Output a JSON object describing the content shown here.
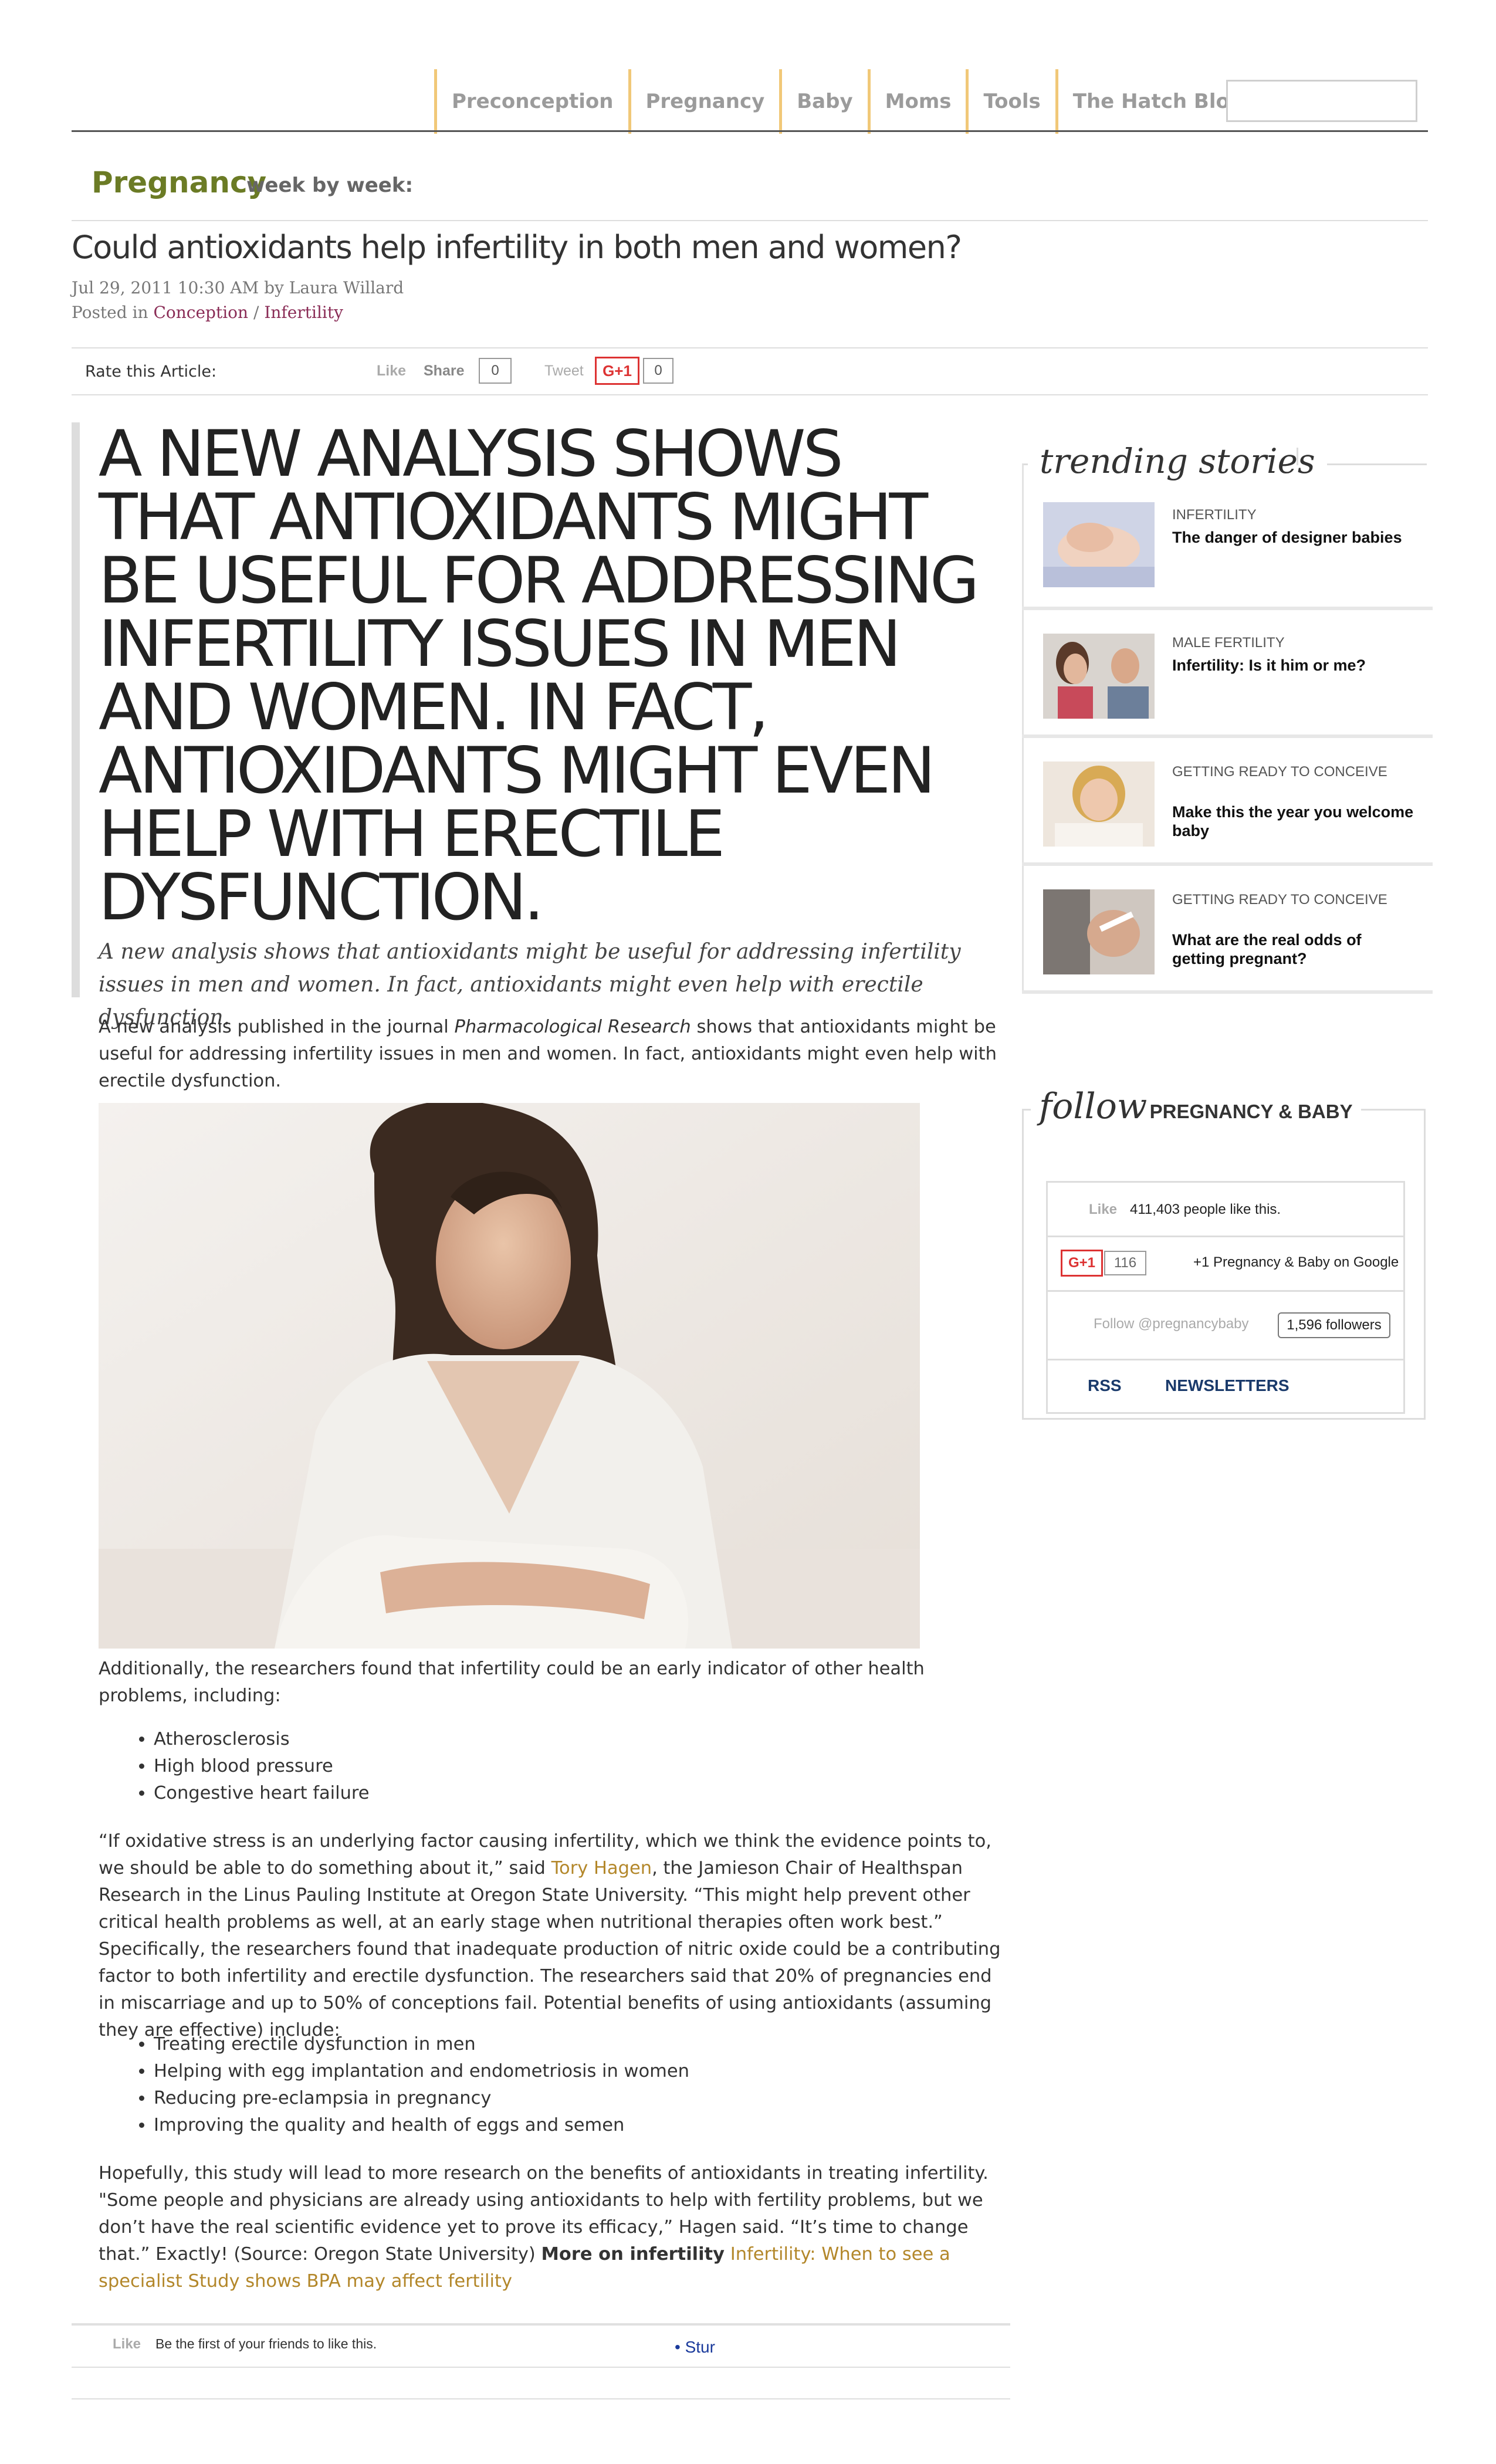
{
  "nav": {
    "items": [
      "Preconception",
      "Pregnancy",
      "Baby",
      "Moms",
      "Tools",
      "The Hatch Blog"
    ],
    "search_placeholder": ""
  },
  "section": {
    "title": "Pregnancy",
    "subtitle": "week by week:"
  },
  "article": {
    "headline": "Could antioxidants help infertility in both men and women?",
    "byline": "Jul 29, 2011 10:30 AM by Laura Willard",
    "posted_prefix": "Posted in",
    "category1": "Conception",
    "category_sep": "/",
    "category2": "Infertility"
  },
  "rate": {
    "label": "Rate this Article:",
    "like": "Like",
    "share": "Share",
    "share_count": "0",
    "tweet": "Tweet",
    "gplus": "G+1",
    "gplus_count": "0"
  },
  "pullquote": {
    "text": "A NEW ANALYSIS SHOWS THAT ANTIOXIDANTS MIGHT BE USEFUL FOR ADDRESSING INFERTILITY ISSUES IN MEN AND WOMEN. IN FACT, ANTIOXIDANTS MIGHT EVEN HELP WITH ERECTILE DYSFUNCTION.",
    "lines": [
      "A NEW ANALYSIS SHOWS",
      "THAT ANTIOXIDANTS MIGHT",
      "BE USEFUL FOR ADDRESSING",
      "INFERTILITY ISSUES IN MEN",
      "AND WOMEN. IN FACT,",
      "ANTIOXIDANTS MIGHT EVEN",
      "HELP WITH ERECTILE",
      "DYSFUNCTION."
    ],
    "subtitle": "A new analysis shows that antioxidants might be useful for addressing infertility issues in men and women. In fact, antioxidants might even help with erectile dysfunction."
  },
  "body": {
    "p1_a": "A new analysis published in the journal ",
    "p1_journal": "Pharmacological Research",
    "p1_b": " shows that antioxidants might be useful for addressing infertility issues in men and women. In fact, antioxidants might even help with erectile dysfunction.",
    "p2": "Additionally, the researchers found that infertility could be an early indicator of other health problems, including:",
    "list1": [
      "Atherosclerosis",
      "High blood pressure",
      "Congestive heart failure"
    ],
    "p3_a": "“If oxidative stress is an underlying factor causing infertility, which we think the evidence points to, we should be able to do something about it,” said ",
    "p3_link": "Tory Hagen",
    "p3_b": ", the Jamieson Chair of Healthspan Research in the Linus Pauling Institute at Oregon State University. “This might help prevent other critical health problems as well, at an early stage when nutritional therapies often work best.” Specifically, the researchers found that inadequate production of nitric oxide could be a contributing factor to both infertility and erectile dysfunction. The researchers said that 20% of pregnancies end in miscarriage and up to 50% of conceptions fail. Potential benefits of using antioxidants (assuming they are effective) include:",
    "list2": [
      "Treating erectile dysfunction in men",
      "Helping with egg implantation and endometriosis in women",
      "Reducing pre-eclampsia in pregnancy",
      "Improving the quality and health of eggs and semen"
    ],
    "p4_a": "Hopefully, this study will lead to more research on the benefits of antioxidants in treating infertility. \"Some people and physicians are already using antioxidants to help with fertility problems, but we don’t have the real scientific evidence yet to prove its efficacy,” Hagen said. “It’s time to change that.” Exactly! (Source: Oregon State University) ",
    "p4_more": "More on infertility",
    "p4_link1": "Infertility: When to see a specialist",
    "p4_link2": "Study shows BPA may affect fertility"
  },
  "footer_bar": {
    "like": "Like",
    "text": "Be the first of your friends to like this.",
    "stumble": "Stur"
  },
  "trending": {
    "title": "trending stories",
    "items": [
      {
        "category": "INFERTILITY",
        "title": "The danger of designer babies"
      },
      {
        "category": "MALE FERTILITY",
        "title": "Infertility: Is it him or me?"
      },
      {
        "category": "GETTING READY TO CONCEIVE",
        "title": "Make this the year you welcome baby"
      },
      {
        "category": "GETTING READY TO CONCEIVE",
        "title": "What are the real odds of getting pregnant?"
      }
    ]
  },
  "follow": {
    "title_script": "follow",
    "title_caps": "PREGNANCY & BABY",
    "fb_like": "Like",
    "fb_text": "411,403 people like this.",
    "gplus": "G+1",
    "gplus_count": "116",
    "gplus_text": "+1 Pregnancy & Baby on Google",
    "twitter_text": "Follow @pregnancybaby",
    "twitter_count": "1,596 followers",
    "rss": "RSS",
    "newsletters": "NEWSLETTERS"
  },
  "colors": {
    "nav_separator": "#f1c878",
    "section_green": "#6b7b25",
    "category_link": "#8a2c56",
    "body_link": "#b3872a",
    "follow_link": "#1a3a6b"
  }
}
